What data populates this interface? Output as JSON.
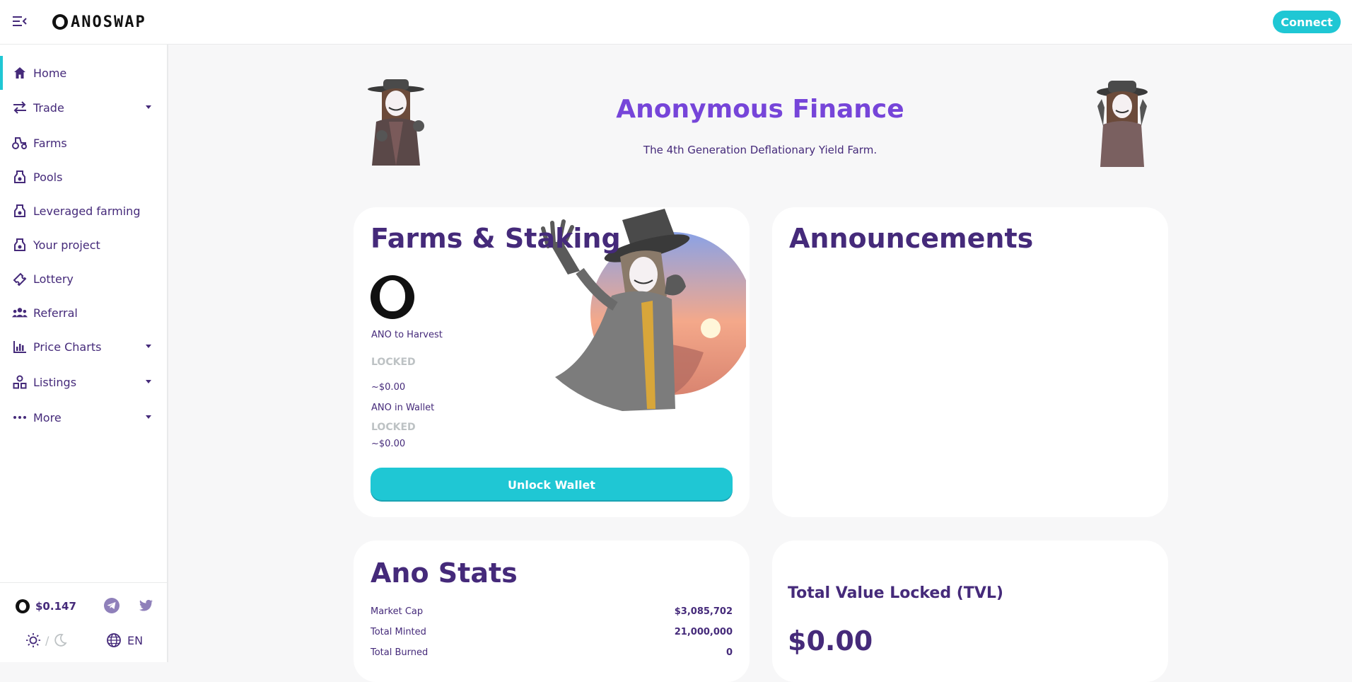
{
  "header": {
    "logo_text": "ANOSWAP",
    "connect_label": "Connect"
  },
  "sidebar": {
    "items": [
      {
        "label": "Home",
        "icon": "home-icon",
        "active": true,
        "caret": false
      },
      {
        "label": "Trade",
        "icon": "swap-icon",
        "active": false,
        "caret": true
      },
      {
        "label": "Farms",
        "icon": "tractor-icon",
        "active": false,
        "caret": false
      },
      {
        "label": "Pools",
        "icon": "pool-icon",
        "active": false,
        "caret": false
      },
      {
        "label": "Leveraged farming",
        "icon": "pool-icon",
        "active": false,
        "caret": false
      },
      {
        "label": "Your project",
        "icon": "pool-icon",
        "active": false,
        "caret": false
      },
      {
        "label": "Lottery",
        "icon": "ticket-icon",
        "active": false,
        "caret": false
      },
      {
        "label": "Referral",
        "icon": "group-icon",
        "active": false,
        "caret": false
      },
      {
        "label": "Price Charts",
        "icon": "chart-icon",
        "active": false,
        "caret": true
      },
      {
        "label": "Listings",
        "icon": "shapes-icon",
        "active": false,
        "caret": true
      },
      {
        "label": "More",
        "icon": "ellipsis-icon",
        "active": false,
        "caret": true
      }
    ],
    "price": "$0.147",
    "theme_separator": "/",
    "language": "EN"
  },
  "hero": {
    "title": "Anonymous Finance",
    "subtitle": "The 4th Generation Deflationary Yield Farm."
  },
  "farms_card": {
    "title": "Farms & Staking",
    "harvest_label": "ANO to Harvest",
    "harvest_value": "LOCKED",
    "harvest_usd": "~$0.00",
    "wallet_label": "ANO in Wallet",
    "wallet_value": "LOCKED",
    "wallet_usd": "~$0.00",
    "unlock_label": "Unlock Wallet"
  },
  "announcements_card": {
    "title": "Announcements"
  },
  "stats_card": {
    "title": "Ano Stats",
    "rows": [
      {
        "label": "Market Cap",
        "value": "$3,085,702"
      },
      {
        "label": "Total Minted",
        "value": "21,000,000"
      },
      {
        "label": "Total Burned",
        "value": "0"
      }
    ]
  },
  "tvl_card": {
    "title": "Total Value Locked (TVL)",
    "value": "$0.00"
  },
  "colors": {
    "accent": "#1fc7d4",
    "primary_text": "#452a7a",
    "title_purple": "#7645d9",
    "locked": "#bdc2c4"
  }
}
